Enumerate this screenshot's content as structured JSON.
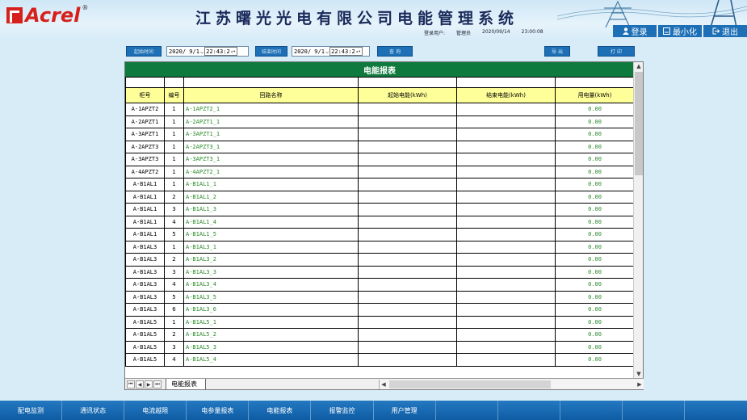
{
  "header": {
    "logo_text": "Acrel",
    "logo_reg": "®",
    "title": "江苏曙光光电有限公司电能管理系统",
    "login_user_label": "登录用户:",
    "login_user": "管理员",
    "date": "2020/09/14",
    "time": "23:00:08",
    "buttons": [
      {
        "label": "登录",
        "icon": "user-icon"
      },
      {
        "label": "最小化",
        "icon": "minimize-icon"
      },
      {
        "label": "退出",
        "icon": "logout-icon"
      }
    ]
  },
  "toolbar": {
    "start_label": "起始时间",
    "start_date": "2020/ 9/1",
    "start_time": "22:43:2",
    "end_label": "结束时间",
    "end_date": "2020/ 9/1",
    "end_time": "22:43:2",
    "query_label": "查 询",
    "export_label": "导 出",
    "print_label": "打 印"
  },
  "report": {
    "title": "电能报表",
    "columns": [
      "柜号",
      "编号",
      "回路名称",
      "起始电能(kWh)",
      "结束电能(kWh)",
      "用电量(kWh)"
    ],
    "rows": [
      [
        "A-1APZT2",
        "1",
        "A-1APZT2_1",
        "",
        "",
        "0.00"
      ],
      [
        "A-2APZT1",
        "1",
        "A-2APZT1_1",
        "",
        "",
        "0.00"
      ],
      [
        "A-3APZT1",
        "1",
        "A-3APZT1_1",
        "",
        "",
        "0.00"
      ],
      [
        "A-2APZT3",
        "1",
        "A-2APZT3_1",
        "",
        "",
        "0.00"
      ],
      [
        "A-3APZT3",
        "1",
        "A-3APZT3_1",
        "",
        "",
        "0.00"
      ],
      [
        "A-4APZT2",
        "1",
        "A-4APZT2_1",
        "",
        "",
        "0.00"
      ],
      [
        "A-B1AL1",
        "1",
        "A-B1AL1_1",
        "",
        "",
        "0.00"
      ],
      [
        "A-B1AL1",
        "2",
        "A-B1AL1_2",
        "",
        "",
        "0.00"
      ],
      [
        "A-B1AL1",
        "3",
        "A-B1AL1_3",
        "",
        "",
        "0.00"
      ],
      [
        "A-B1AL1",
        "4",
        "A-B1AL1_4",
        "",
        "",
        "0.00"
      ],
      [
        "A-B1AL1",
        "5",
        "A-B1AL1_5",
        "",
        "",
        "0.00"
      ],
      [
        "A-B1AL3",
        "1",
        "A-B1AL3_1",
        "",
        "",
        "0.00"
      ],
      [
        "A-B1AL3",
        "2",
        "A-B1AL3_2",
        "",
        "",
        "0.00"
      ],
      [
        "A-B1AL3",
        "3",
        "A-B1AL3_3",
        "",
        "",
        "0.00"
      ],
      [
        "A-B1AL3",
        "4",
        "A-B1AL3_4",
        "",
        "",
        "0.00"
      ],
      [
        "A-B1AL3",
        "5",
        "A-B1AL3_5",
        "",
        "",
        "0.00"
      ],
      [
        "A-B1AL3",
        "6",
        "A-B1AL3_6",
        "",
        "",
        "0.00"
      ],
      [
        "A-B1AL5",
        "1",
        "A-B1AL5_1",
        "",
        "",
        "0.00"
      ],
      [
        "A-B1AL5",
        "2",
        "A-B1AL5_2",
        "",
        "",
        "0.00"
      ],
      [
        "A-B1AL5",
        "3",
        "A-B1AL5_3",
        "",
        "",
        "0.00"
      ],
      [
        "A-B1AL5",
        "4",
        "A-B1AL5_4",
        "",
        "",
        "0.00"
      ]
    ],
    "sheet_tab": "电能报表"
  },
  "bottom_nav": [
    "配电监测",
    "通讯状态",
    "电流越限",
    "电参量报表",
    "电能报表",
    "报警监控",
    "用户管理",
    "",
    "",
    "",
    "",
    ""
  ],
  "colors": {
    "title_bar": "#0f7a3d",
    "header_row": "#ffff99",
    "accent_blue": "#1d6fb6",
    "value_green": "#2a8a2a",
    "logo_red": "#d6201c"
  }
}
